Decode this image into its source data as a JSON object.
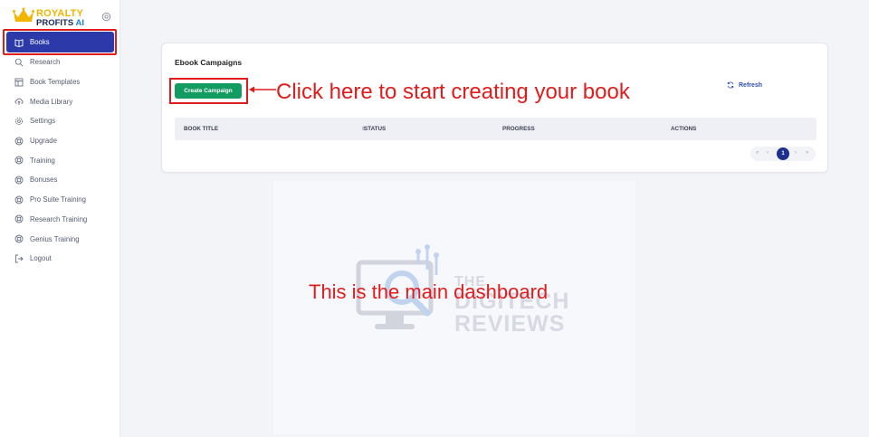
{
  "brand": {
    "line1": "ROYALTY",
    "line2_a": "PROFITS ",
    "line2_b": "AI",
    "colors": {
      "gold": "#f2b600",
      "navy": "#1a2a5e",
      "blue": "#1f7ee0"
    }
  },
  "sidebar": {
    "items": [
      {
        "label": "Books",
        "icon": "book-icon",
        "active": true
      },
      {
        "label": "Research",
        "icon": "search-icon"
      },
      {
        "label": "Book Templates",
        "icon": "template-icon"
      },
      {
        "label": "Media Library",
        "icon": "cloud-upload-icon"
      },
      {
        "label": "Settings",
        "icon": "gear-icon"
      },
      {
        "label": "Upgrade",
        "icon": "lifebuoy-icon"
      },
      {
        "label": "Training",
        "icon": "lifebuoy-icon"
      },
      {
        "label": "Bonuses",
        "icon": "lifebuoy-icon"
      },
      {
        "label": "Pro Suite Training",
        "icon": "lifebuoy-icon"
      },
      {
        "label": "Research Training",
        "icon": "lifebuoy-icon"
      },
      {
        "label": "Genius Training",
        "icon": "lifebuoy-icon"
      },
      {
        "label": "Logout",
        "icon": "logout-icon"
      }
    ],
    "active_color": "#2b3aa8"
  },
  "main": {
    "card_title": "Ebook Campaigns",
    "create_button": "Create Campaign",
    "refresh_label": "Refresh",
    "table": {
      "columns": [
        "BOOK TITLE",
        "STATUS",
        "PROGRESS",
        "ACTIONS"
      ]
    },
    "pagination": {
      "first": "«",
      "prev": "‹",
      "current": "1",
      "next": "›",
      "last": "»"
    },
    "button_color": "#129c62"
  },
  "annotations": {
    "click_here": "Click here to start creating your book",
    "main_dashboard": "This is the main dashboard",
    "color": "#e21c1c"
  },
  "watermark": {
    "line1": "THE",
    "line2": "DIGITECH",
    "line3": "REVIEWS"
  }
}
